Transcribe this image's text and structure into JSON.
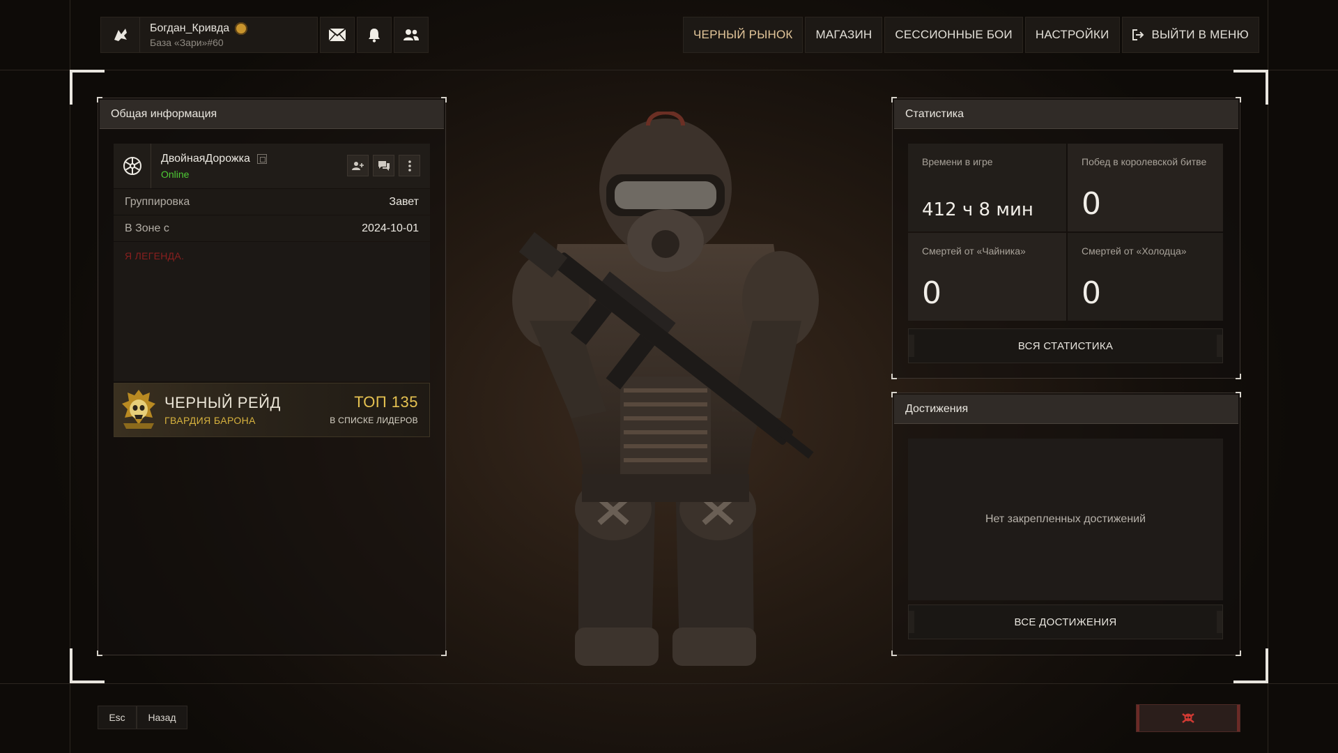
{
  "user": {
    "name": "Богдан_Кривда",
    "base": "База «Зари»#60"
  },
  "topnav": {
    "black_market": "ЧЕРНЫЙ РЫНОК",
    "shop": "МАГАЗИН",
    "session_battles": "СЕССИОННЫЕ БОИ",
    "settings": "НАСТРОЙКИ",
    "exit_menu": "ВЫЙТИ В МЕНЮ"
  },
  "general": {
    "title": "Общая информация",
    "profile_name": "ДвойнаяДорожка",
    "status": "Online",
    "rows": [
      {
        "label": "Группировка",
        "value": "Завет"
      },
      {
        "label": "В Зоне с",
        "value": "2024-10-01"
      }
    ],
    "bio": "Я ЛЕГЕНДА.",
    "raid": {
      "title": "ЧЕРНЫЙ РЕЙД",
      "subtitle": "ГВАРДИЯ БАРОНА",
      "rank": "ТОП 135",
      "rank_sub": "В СПИСКЕ ЛИДЕРОВ"
    }
  },
  "stats": {
    "title": "Статистика",
    "cells": [
      {
        "label": "Времени в игре",
        "value": "412 ч 8 мин"
      },
      {
        "label": "Побед в королевской битве",
        "value": "0"
      },
      {
        "label": "Смертей от «Чайника»",
        "value": "0"
      },
      {
        "label": "Смертей от «Холодца»",
        "value": "0"
      }
    ],
    "all_button": "ВСЯ СТАТИСТИКА"
  },
  "achievements": {
    "title": "Достижения",
    "empty": "Нет закрепленных достижений",
    "all_button": "ВСЕ ДОСТИЖЕНИЯ"
  },
  "bottom": {
    "esc": "Esc",
    "back": "Назад"
  },
  "colors": {
    "online": "#4ecb35",
    "bio": "#8a1f1f",
    "raid_gold": "#e6c251",
    "accent_nav": "#e3c69a",
    "exit_red": "#c9302c"
  },
  "icons": {
    "user_logo": "faction-logo-icon",
    "mail": "mail-icon",
    "bell": "bell-icon",
    "friends": "friends-icon",
    "exit": "exit-icon",
    "profile_logo": "snowflake-faction-icon",
    "add_friend": "add-friend-icon",
    "chat": "chat-icon",
    "more": "more-vertical-icon",
    "raid_emblem": "skull-emblem-icon",
    "exit_skull": "skull-crossbones-icon"
  }
}
